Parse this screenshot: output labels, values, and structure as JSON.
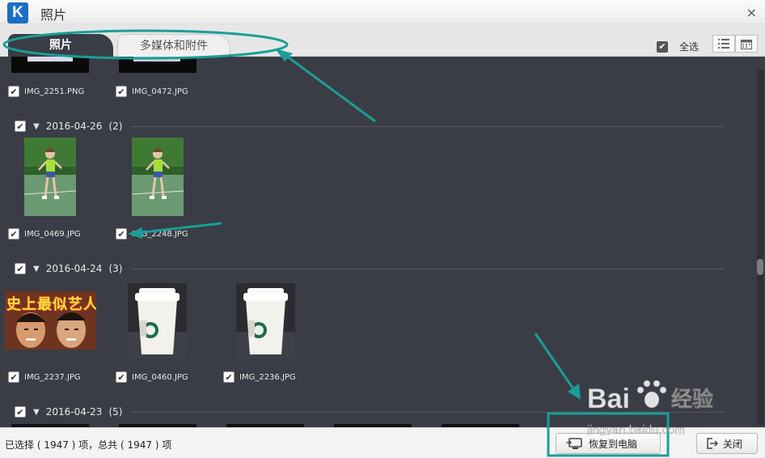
{
  "window": {
    "title": "照片",
    "logo_letter": "K",
    "close_symbol": "×"
  },
  "tabs": [
    {
      "label": "照片",
      "active": true
    },
    {
      "label": "多媒体和附件",
      "active": false
    }
  ],
  "toolbar": {
    "select_all_label": "全选",
    "select_all_checked": true,
    "views": [
      "list-view-icon",
      "calendar-view-icon"
    ]
  },
  "items_top": [
    {
      "name": "IMG_2251.PNG",
      "checked": true
    },
    {
      "name": "IMG_0472.JPG",
      "checked": true
    }
  ],
  "groups": [
    {
      "date": "2016-04-26",
      "count": "(2)",
      "checked": true,
      "items": [
        {
          "name": "IMG_0469.JPG",
          "checked": true,
          "thumb": "tennis-photo"
        },
        {
          "name": "IMG_2248.JPG",
          "checked": true,
          "thumb": "tennis-photo"
        }
      ]
    },
    {
      "date": "2016-04-24",
      "count": "(3)",
      "checked": true,
      "items": [
        {
          "name": "IMG_2237.JPG",
          "checked": true,
          "thumb": "meme-photo",
          "caption": "史上最似艺人"
        },
        {
          "name": "IMG_0460.JPG",
          "checked": true,
          "thumb": "coffee-cup-photo"
        },
        {
          "name": "IMG_2236.JPG",
          "checked": true,
          "thumb": "coffee-cup-photo"
        }
      ]
    },
    {
      "date": "2016-04-23",
      "count": "(5)",
      "checked": true,
      "items": []
    }
  ],
  "footer": {
    "status": "已选择 ( 1947 ) 项，总共 ( 1947 ) 项",
    "restore_label": "恢复到电脑",
    "close_label": "关闭"
  },
  "watermark": {
    "brand_left": "Bai",
    "brand_right": "经验",
    "url": "jingyan.baidu.com"
  },
  "colors": {
    "panel": "#3a3d45",
    "annotation": "#1a9e97",
    "logo": "#1a6fc4"
  }
}
